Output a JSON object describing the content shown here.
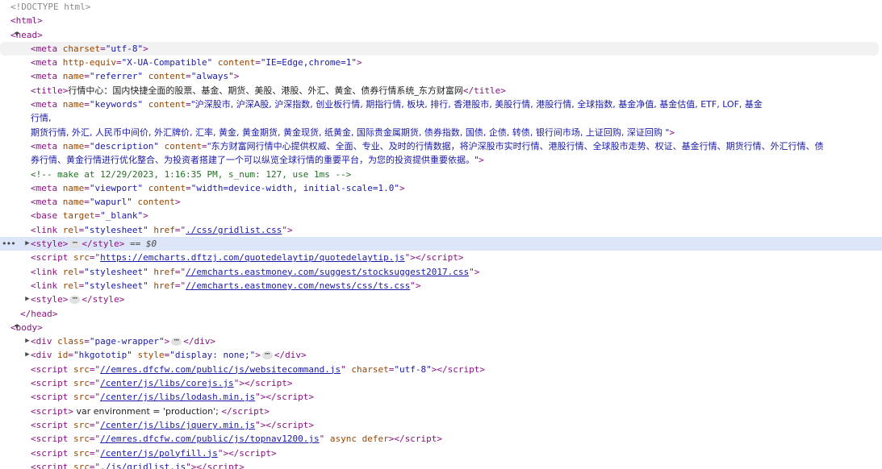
{
  "lines": [
    {
      "indent": 1,
      "kind": "doctype",
      "text": "<!DOCTYPE html>"
    },
    {
      "indent": 1,
      "kind": "open",
      "tag": "html"
    },
    {
      "indent": 1,
      "kind": "toggle-open",
      "tag": "head",
      "toggle": "▼"
    },
    {
      "indent": 3,
      "kind": "meta",
      "parts": [
        {
          "a": "charset",
          "v": "\"utf-8\""
        }
      ],
      "hover": true
    },
    {
      "indent": 3,
      "kind": "meta",
      "parts": [
        {
          "a": "http-equiv",
          "v": "\"X-UA-Compatible\""
        },
        {
          "a": "content",
          "v": "\"IE=Edge,chrome=1\""
        }
      ]
    },
    {
      "indent": 3,
      "kind": "meta",
      "parts": [
        {
          "a": "name",
          "v": "\"referrer\""
        },
        {
          "a": "content",
          "v": "\"always\""
        }
      ]
    },
    {
      "indent": 3,
      "kind": "title",
      "text": "行情中心：国内快捷全面的股票、基金、期货、美股、港股、外汇、黄金、债券行情系统_东方财富网"
    },
    {
      "indent": 3,
      "kind": "meta-long",
      "a1": "name",
      "v1": "\"keywords\"",
      "a2": "content",
      "v2a": "\"沪深股市, 沪深A股, 沪深指数, 创业板行情, 期指行情, 板块, 排行, 香港股市, 美股行情, 港股行情, 全球指数, 基金净值, 基金估值, ETF, LOF, 基金",
      "v2b": "行情,",
      "v2c": "期货行情, 外汇, 人民币中间价, 外汇牌价, 汇率, 黄金, 黄金期货, 黄金现货, 纸黄金, 国际贵金属期货, 债券指数, 国债, 企债, 转债, 银行间市场, 上证回购, 深证回购 \""
    },
    {
      "indent": 3,
      "kind": "meta-desc",
      "a1": "name",
      "v1": "\"description\"",
      "a2": "content",
      "v2a": "\"东方财富网行情中心提供权威、全面、专业、及时的行情数据，将沪深股市实时行情、港股行情、全球股市走势、权证、基金行情、期货行情、外汇行情、债",
      "v2b": "券行情、黄金行情进行优化整合、为投资者搭建了一个可以纵览全球行情的重要平台，为您的投资提供重要依据。\""
    },
    {
      "indent": 3,
      "kind": "comment",
      "text": "<!-- make at 12/29/2023, 1:16:35 PM, s_num: 127, use 1ms -->"
    },
    {
      "indent": 3,
      "kind": "meta",
      "parts": [
        {
          "a": "name",
          "v": "\"viewport\""
        },
        {
          "a": "content",
          "v": "\"width=device-width, initial-scale=1.0\""
        }
      ]
    },
    {
      "indent": 3,
      "kind": "meta",
      "parts": [
        {
          "a": "name",
          "v": "\"wapurl\""
        },
        {
          "a": "content",
          "v": ""
        }
      ]
    },
    {
      "indent": 3,
      "kind": "base",
      "parts": [
        {
          "a": "target",
          "v": "\"_blank\""
        }
      ]
    },
    {
      "indent": 3,
      "kind": "link",
      "rel": "\"stylesheet\"",
      "href": "./css/gridlist.css"
    },
    {
      "indent": 3,
      "kind": "style-sel",
      "toggle": "▶",
      "selected": true,
      "suffix": " == $0"
    },
    {
      "indent": 3,
      "kind": "script",
      "src": "https://emcharts.dftzj.com/quotedelaytip/quotedelaytip.js",
      "extra": ""
    },
    {
      "indent": 3,
      "kind": "link",
      "rel": "\"stylesheet\"",
      "href": "//emcharts.eastmoney.com/suggest/stocksuggest2017.css"
    },
    {
      "indent": 3,
      "kind": "link",
      "rel": "\"stylesheet\"",
      "href": "//emcharts.eastmoney.com/newsts/css/ts.css"
    },
    {
      "indent": 3,
      "kind": "style",
      "toggle": "▶"
    },
    {
      "indent": 2,
      "kind": "close",
      "tag": "head"
    },
    {
      "indent": 1,
      "kind": "toggle-open",
      "tag": "body",
      "toggle": "▼"
    },
    {
      "indent": 3,
      "kind": "div",
      "toggle": "▶",
      "parts": [
        {
          "a": "class",
          "v": "\"page-wrapper\""
        }
      ]
    },
    {
      "indent": 3,
      "kind": "div",
      "toggle": "▶",
      "parts": [
        {
          "a": "id",
          "v": "\"hkgototip\""
        },
        {
          "a": "style",
          "v": "\"display: none;\""
        }
      ]
    },
    {
      "indent": 3,
      "kind": "script",
      "src": "//emres.dfcfw.com/public/js/websitecommand.js",
      "extra": " charset=\"utf-8\""
    },
    {
      "indent": 3,
      "kind": "script",
      "src": "/center/js/libs/corejs.js",
      "extra": ""
    },
    {
      "indent": 3,
      "kind": "script",
      "src": "/center/js/libs/lodash.min.js",
      "extra": ""
    },
    {
      "indent": 3,
      "kind": "inline-script",
      "text": " var environment = 'production'; "
    },
    {
      "indent": 3,
      "kind": "script",
      "src": "/center/js/libs/jquery.min.js",
      "extra": ""
    },
    {
      "indent": 3,
      "kind": "script",
      "src": "//emres.dfcfw.com/public/js/topnav1200.js",
      "extra": " async defer"
    },
    {
      "indent": 3,
      "kind": "script",
      "src": "/center/js/polyfill.js",
      "extra": ""
    },
    {
      "indent": 3,
      "kind": "script",
      "src": "./js/gridlist.js",
      "extra": ""
    }
  ],
  "ellipsis_marker": "⋯",
  "gutter_dots": "•••"
}
